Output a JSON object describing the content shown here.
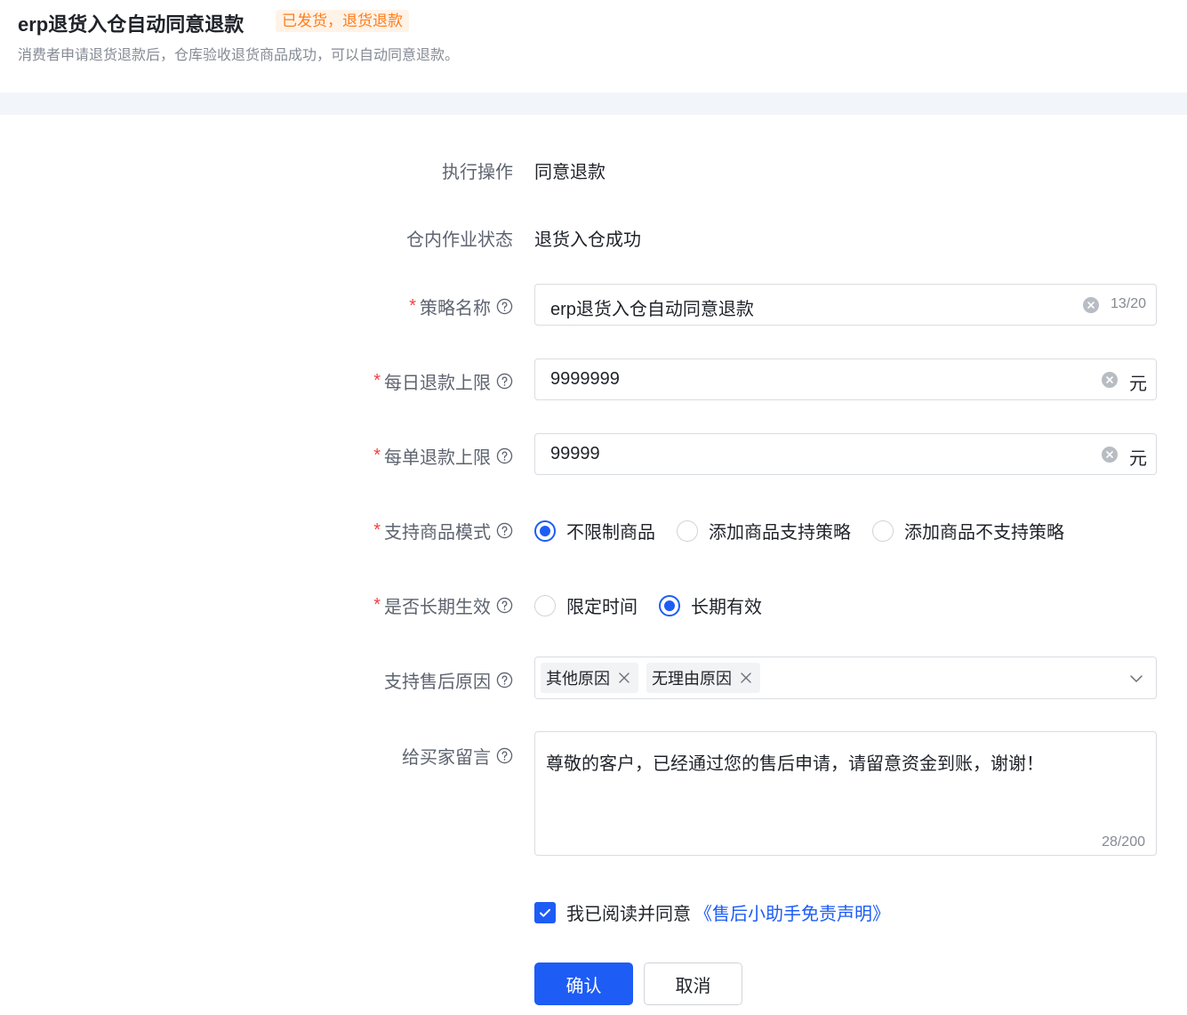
{
  "header": {
    "title": "erp退货入仓自动同意退款",
    "status_tag": "已发货，退货退款",
    "subtitle": "消费者申请退货退款后，仓库验收退货商品成功，可以自动同意退款。"
  },
  "form": {
    "action": {
      "label": "执行操作",
      "value": "同意退款"
    },
    "warehouse_status": {
      "label": "仓内作业状态",
      "value": "退货入仓成功"
    },
    "strategy_name": {
      "label": "策略名称",
      "required": true,
      "value": "erp退货入仓自动同意退款",
      "count": "13/20"
    },
    "daily_limit": {
      "label": "每日退款上限",
      "required": true,
      "value": "9999999",
      "unit": "元"
    },
    "order_limit": {
      "label": "每单退款上限",
      "required": true,
      "value": "99999",
      "unit": "元"
    },
    "product_mode": {
      "label": "支持商品模式",
      "required": true,
      "options": [
        "不限制商品",
        "添加商品支持策略",
        "添加商品不支持策略"
      ],
      "selected": "不限制商品"
    },
    "long_term": {
      "label": "是否长期生效",
      "required": true,
      "options": [
        "限定时间",
        "长期有效"
      ],
      "selected": "长期有效"
    },
    "reasons": {
      "label": "支持售后原因",
      "tags": [
        "其他原因",
        "无理由原因"
      ]
    },
    "message": {
      "label": "给买家留言",
      "value": "尊敬的客户，已经通过您的售后申请，请留意资金到账，谢谢！",
      "count": "28/200"
    },
    "agreement": {
      "text": "我已阅读并同意",
      "link": "《售后小助手免责声明》",
      "checked": true
    },
    "buttons": {
      "confirm": "确认",
      "cancel": "取消"
    }
  },
  "colors": {
    "primary": "#1d5cf5",
    "required": "#f53f3f",
    "tag_text": "#ff7d1a",
    "tag_bg": "#fff3e8"
  }
}
